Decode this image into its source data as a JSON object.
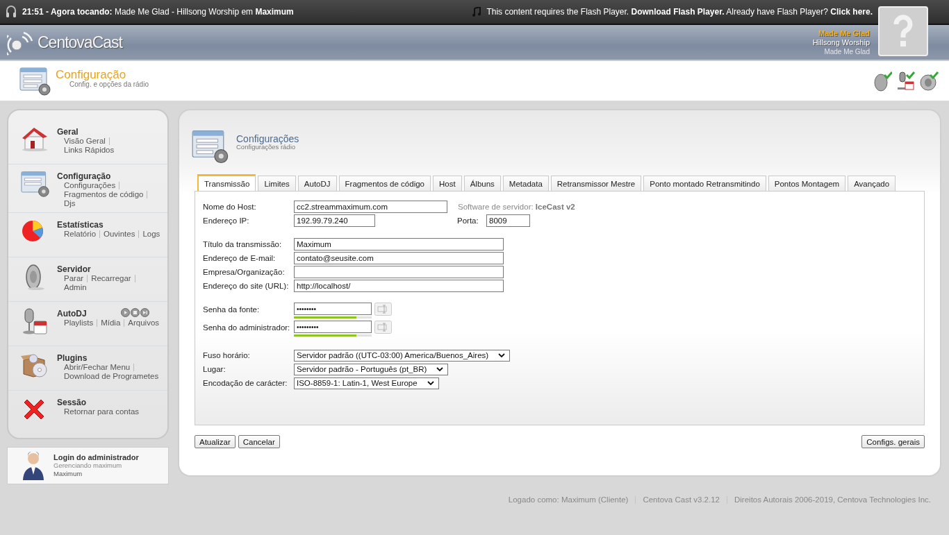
{
  "player_bar": {
    "now_playing": "**21:51 - Agora tocando:** Made Me Glad - Hillsong Worship em **Maximum**",
    "flash_notice": "This content requires the Flash Player. **Download Flash Player.** Already have Flash Player? **Click here.**"
  },
  "header": {
    "logo": "CentovaCast",
    "track": {
      "title": "Made Me Glad",
      "artist": "Hillsong Worship",
      "album": "Made Me Glad"
    }
  },
  "page_header": {
    "title": "Configuração",
    "subtitle": "Config. e opções da rádio",
    "tools": [
      {
        "kind": "dish"
      },
      {
        "kind": "mic"
      },
      {
        "kind": "speaker"
      }
    ]
  },
  "sidebar": {
    "sections": [
      {
        "kind": "house",
        "title": "Geral",
        "links": [
          "Visão Geral",
          "Links Rápidos"
        ]
      },
      {
        "kind": "form",
        "title": "Configuração",
        "links": [
          "Configurações",
          "Fragmentos de código",
          "Djs"
        ]
      },
      {
        "kind": "pie",
        "title": "Estatísticas",
        "links": [
          "Relatório",
          "Ouvintes",
          "Logs"
        ]
      },
      {
        "kind": "dish",
        "title": "Servidor",
        "links": [
          "Parar",
          "Recarregar",
          "Admin"
        ]
      },
      {
        "kind": "mic",
        "title": "AutoDJ",
        "links": [
          "Playlists",
          "Mídia",
          "Arquivos"
        ],
        "controls": [
          {
            "kind": "play"
          },
          {
            "kind": "stop"
          },
          {
            "kind": "skip"
          }
        ]
      },
      {
        "kind": "box",
        "title": "Plugins",
        "links": [
          "Abrir/Fechar Menu",
          "Download de Programetes"
        ]
      },
      {
        "kind": "cross",
        "title": "Sessão",
        "links": [
          "Retornar para contas"
        ]
      }
    ]
  },
  "admin": {
    "title": "Login do administrador",
    "subtitle": "Gerenciando maximum",
    "account": "Maximum"
  },
  "panel": {
    "title": "Configurações",
    "subtitle": "Configurações rádio",
    "tabs": [
      {
        "label": "Transmissão",
        "selected": true
      },
      {
        "label": "Limites",
        "selected": false
      },
      {
        "label": "AutoDJ",
        "selected": false
      },
      {
        "label": "Fragmentos de código",
        "selected": false
      },
      {
        "label": "Host",
        "selected": false
      },
      {
        "label": "Álbuns",
        "selected": false
      },
      {
        "label": "Metadata",
        "selected": false
      },
      {
        "label": "Retransmissor Mestre",
        "selected": false
      },
      {
        "label": "Ponto montado Retransmitindo",
        "selected": false
      },
      {
        "label": "Pontos Montagem",
        "selected": false
      },
      {
        "label": "Avançado",
        "selected": false
      }
    ],
    "server": {
      "host_label": "Nome do Host:",
      "host": "cc2.streammaximum.com",
      "software": "Software de servidor: **IceCast v2**",
      "ip_label": "Endereço IP:",
      "ip": "192.99.79.240",
      "port_label": "Porta:",
      "port": "8009"
    },
    "groups": [
      [
        {
          "kind": "text",
          "label": "Título da transmissão:",
          "value": "Maximum"
        },
        {
          "kind": "text",
          "label": "Endereço de E-mail:",
          "value": "contato@seusite.com"
        },
        {
          "kind": "text",
          "label": "Empresa/Organização:"
        },
        {
          "kind": "text",
          "label": "Endereço do site (URL):",
          "value": "http://localhost/"
        }
      ],
      [
        {
          "kind": "password",
          "label": "Senha da fonte:",
          "value": "••••••••",
          "level": 0.8
        },
        {
          "kind": "password",
          "label": "Senha do administrador:",
          "value": "•••••••••",
          "level": 0.8
        }
      ],
      [
        {
          "kind": "select",
          "label": "Fuso horário:",
          "value": "Servidor padrão ((UTC-03:00) America/Buenos_Aires)"
        },
        {
          "kind": "select",
          "label": "Lugar:",
          "value": "Servidor padrão - Português (pt_BR)"
        },
        {
          "kind": "select",
          "label": "Encodação de carácter:",
          "value": "ISO-8859-1: Latin-1, West Europe"
        }
      ]
    ],
    "buttons": [
      "Atualizar",
      "Cancelar"
    ],
    "general_button": "Configs. gerais"
  },
  "footer": [
    "Logado como: Maximum (Cliente)",
    "Centova Cast v3.2.12",
    "Direitos Autorais 2006-2019, Centova Technologies Inc."
  ]
}
